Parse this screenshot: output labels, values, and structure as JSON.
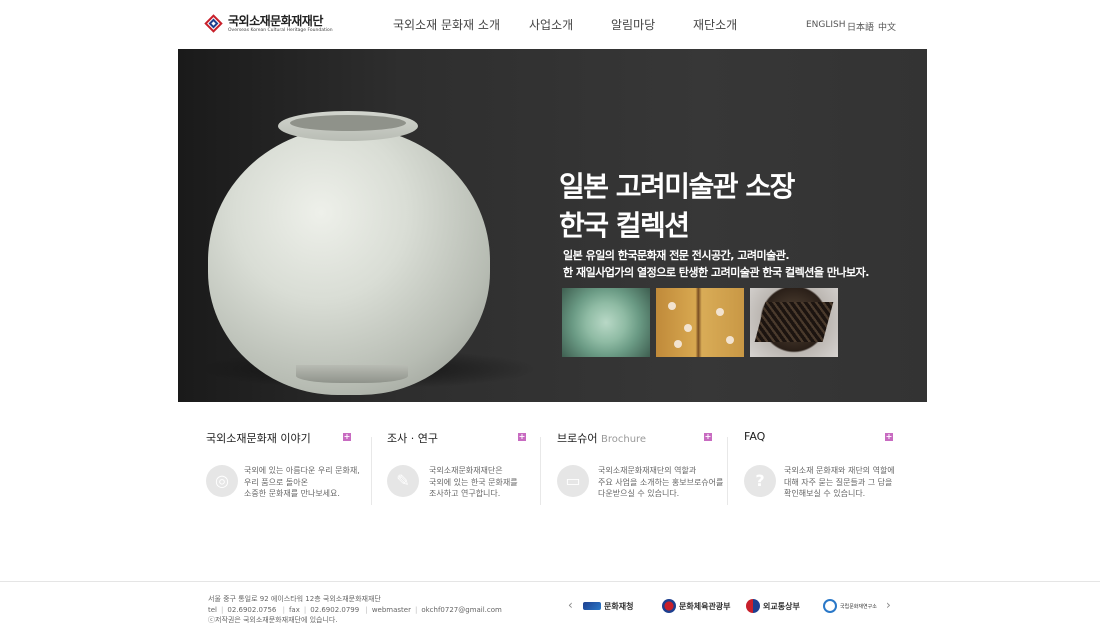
{
  "header": {
    "logo_title": "국외소재문화재재단",
    "logo_sub": "Overseas Korean Cultural Heritage Foundation",
    "nav": [
      "국외소재 문화재 소개",
      "사업소개",
      "알림마당",
      "재단소개"
    ],
    "languages": [
      "ENGLISH",
      "日本語",
      "中文"
    ]
  },
  "hero": {
    "title_line1": "일본 고려미술관 소장",
    "title_line2": "한국 컬렉션",
    "desc_line1": "일본 유일의 한국문화재 전문 전시공간, 고려미술관.",
    "desc_line2": "한 재일사업가의 열정으로 탄생한 고려미술관 한국 컬렉션을 만나보자."
  },
  "columns": [
    {
      "title": "국외소재문화재 이야기",
      "title_en": "",
      "icon": "target-icon",
      "lines": [
        "국외에 있는 아름다운 우리 문화재,",
        "우리 품으로 돌아온",
        "소중한 문화재를 만나보세요."
      ]
    },
    {
      "title": "조사 · 연구",
      "title_en": "",
      "icon": "pen-icon",
      "lines": [
        "국외소재문화재재단은",
        "국외에 있는 한국 문화재를",
        "조사하고 연구합니다."
      ]
    },
    {
      "title": "브로슈어",
      "title_en": "Brochure",
      "icon": "book-icon",
      "lines": [
        "국외소재문화재재단의 역할과",
        "주요 사업을 소개하는 홍보브로슈어를",
        "다운받으실 수 있습니다."
      ]
    },
    {
      "title": "FAQ",
      "title_en": "",
      "icon": "question-icon",
      "lines": [
        "국외소재 문화재와 재단의 역할에",
        "대해 자주 묻는 질문들과 그 답을",
        "확인해보실 수 있습니다."
      ]
    }
  ],
  "footer": {
    "address": "서울 중구 통일로 92 에이스타워 12층 국외소재문화재재단",
    "tel_label": "tel",
    "tel": "02.6902.0756",
    "fax_label": "fax",
    "fax": "02.6902.0799",
    "webmaster_label": "webmaster",
    "email": "okchf0727@gmail.com",
    "copyright": "ⓒ저작권은 국외소재문화재재단에 있습니다.",
    "partners": [
      "문화재청",
      "문화체육관광부",
      "외교통상부",
      "국립문화재연구소"
    ]
  },
  "colors": {
    "accent": "#c86bc1",
    "logo_red": "#c8202b",
    "logo_blue": "#1d3f8f",
    "hero_bg": "#333333"
  }
}
